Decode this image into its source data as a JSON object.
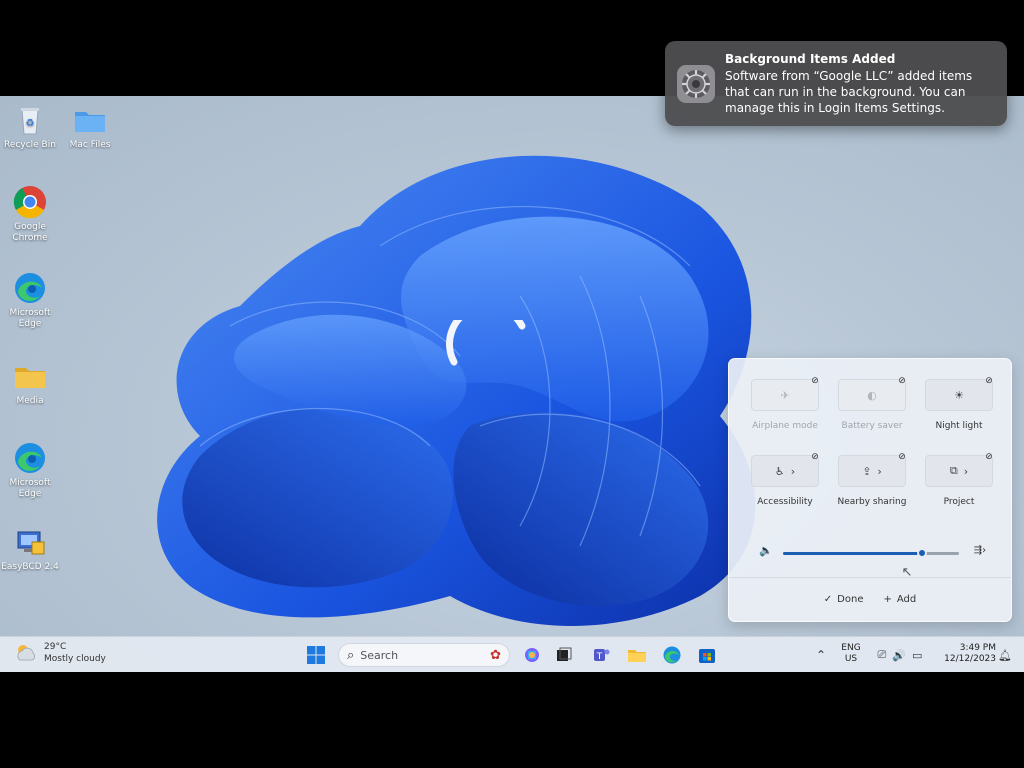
{
  "notification": {
    "title": "Background Items Added",
    "body": "Software from “Google LLC” added items that can run in the background. You can manage this in Login Items Settings.",
    "icon": "gear-settings-icon"
  },
  "desktop": {
    "icons": [
      {
        "label": "Recycle Bin",
        "icon": "recycle-bin-icon"
      },
      {
        "label": "Mac Files",
        "icon": "folder-icon"
      },
      {
        "label": "Google Chrome",
        "icon": "chrome-icon"
      },
      {
        "label": "Microsoft Edge",
        "icon": "edge-icon"
      },
      {
        "label": "Media",
        "icon": "folder-icon"
      },
      {
        "label": "Microsoft Edge",
        "icon": "edge-icon"
      },
      {
        "label": "EasyBCD 2.4",
        "icon": "easybcd-icon"
      }
    ]
  },
  "quick_settings": {
    "tiles": [
      {
        "label": "Airplane mode",
        "icon": "airplane-icon",
        "enabled": false
      },
      {
        "label": "Battery saver",
        "icon": "battery-icon",
        "enabled": false
      },
      {
        "label": "Night light",
        "icon": "night-light-icon",
        "enabled": true
      },
      {
        "label": "Accessibility",
        "icon": "accessibility-icon",
        "enabled": true
      },
      {
        "label": "Nearby sharing",
        "icon": "share-icon",
        "enabled": true
      },
      {
        "label": "Project",
        "icon": "project-icon",
        "enabled": true
      }
    ],
    "volume_level": 0.79,
    "done_label": "Done",
    "add_label": "Add"
  },
  "taskbar": {
    "weather_temp": "29°C",
    "weather_desc": "Mostly cloudy",
    "search_placeholder": "Search",
    "language_line1": "ENG",
    "language_line2": "US",
    "time": "3:49 PM",
    "date": "12/12/2023"
  },
  "colors": {
    "accent": "#1a5fb4",
    "wallpaper_blue": "#1f5ee8",
    "notification_bg": "#4e4e50"
  }
}
